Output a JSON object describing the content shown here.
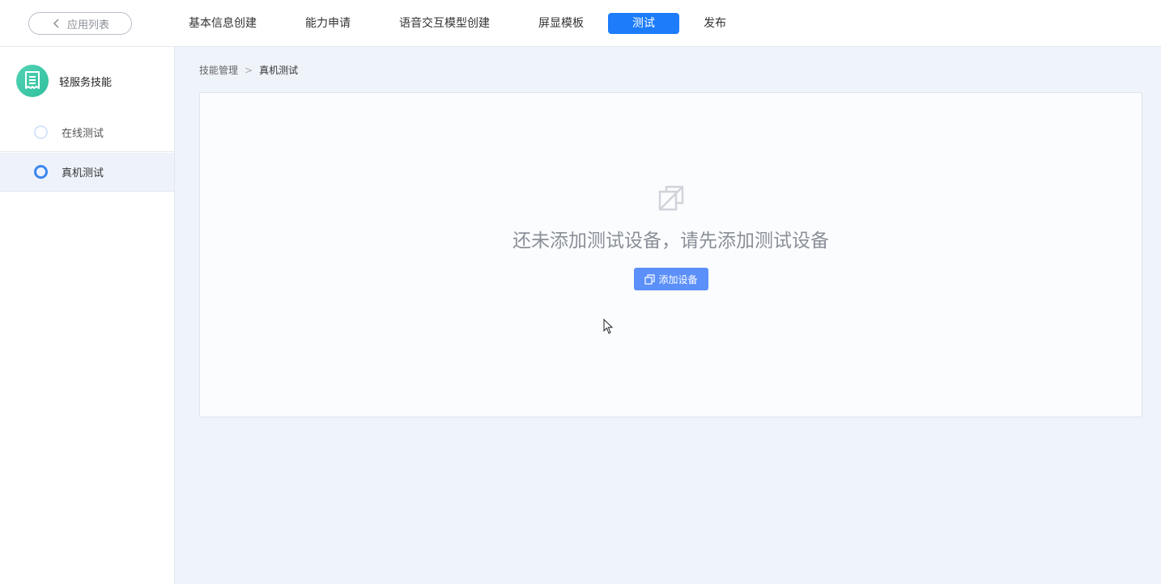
{
  "header": {
    "back_label": "应用列表",
    "tabs": [
      {
        "label": "基本信息创建"
      },
      {
        "label": "能力申请"
      },
      {
        "label": "语音交互模型创建"
      },
      {
        "label": "屏显模板"
      },
      {
        "label": "测试"
      },
      {
        "label": "发布"
      }
    ],
    "active_tab": "测试"
  },
  "sidebar": {
    "skill_name": "轻服务技能",
    "items": [
      {
        "label": "在线测试"
      },
      {
        "label": "真机测试"
      }
    ],
    "active_item": "真机测试"
  },
  "breadcrumb": {
    "parent": "技能管理",
    "current": "真机测试"
  },
  "main": {
    "empty_message": "还未添加测试设备，请先添加测试设备",
    "add_button_label": "添加设备"
  },
  "colors": {
    "accent": "#1c7cfa",
    "button": "#5b8ff9",
    "logo": "#2fbf9c",
    "active_dot": "#3c86f0"
  },
  "icons": [
    "chevron-left-icon",
    "skill-document-icon",
    "no-device-icon",
    "copy-icon",
    "mouse-cursor-icon"
  ]
}
